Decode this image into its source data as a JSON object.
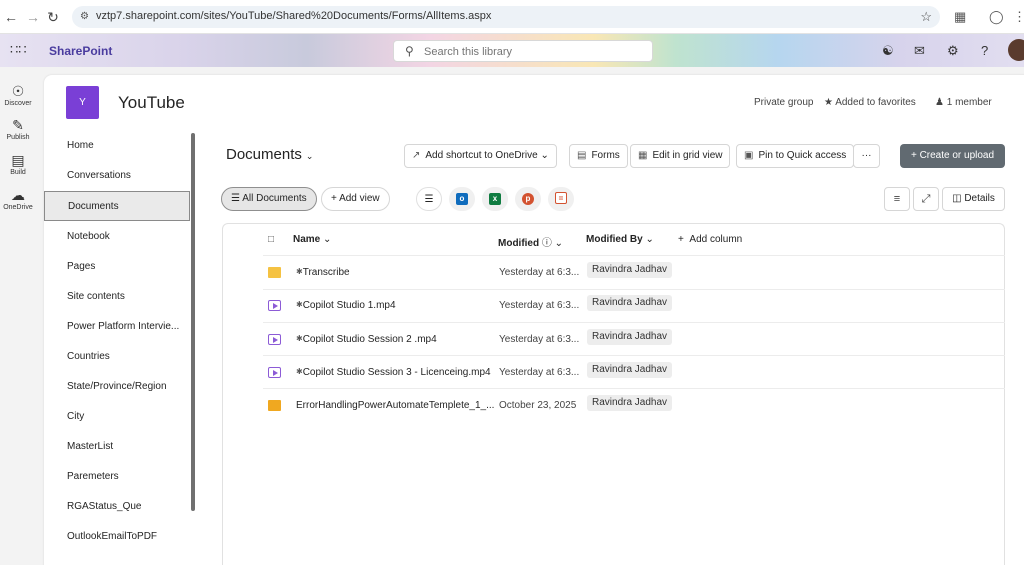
{
  "browser": {
    "url": "vztp7.sharepoint.com/sites/YouTube/Shared%20Documents/Forms/AllItems.aspx"
  },
  "header": {
    "brand": "SharePoint",
    "search_placeholder": "Search this library"
  },
  "app_bar": {
    "items": [
      {
        "label": "Discover",
        "icon": "compass-icon"
      },
      {
        "label": "Publish",
        "icon": "pen-icon"
      },
      {
        "label": "Build",
        "icon": "build-icon"
      },
      {
        "label": "OneDrive",
        "icon": "cloud-icon"
      }
    ]
  },
  "site": {
    "logo_letter": "Y",
    "title": "YouTube",
    "privacy": "Private group",
    "favorites": "Added to favorites",
    "members": "1 member",
    "accent": "#7a3fd6"
  },
  "nav": {
    "items": [
      "Home",
      "Conversations",
      "Documents",
      "Notebook",
      "Pages",
      "Site contents",
      "Power Platform Intervie...",
      "Countries",
      "State/Province/Region",
      "City",
      "MasterList",
      "Paremeters",
      "RGAStatus_Que",
      "OutlookEmailToPDF"
    ],
    "selected": "Documents"
  },
  "library": {
    "title": "Documents",
    "commands": {
      "shortcut": "Add shortcut to OneDrive",
      "forms": "Forms",
      "grid": "Edit in grid view",
      "pin": "Pin to Quick access",
      "more": "···",
      "create": "Create or upload"
    },
    "views": {
      "active": "All Documents",
      "add": "Add view",
      "details": "Details"
    },
    "columns": {
      "name": "Name",
      "modified": "Modified",
      "modified_by": "Modified By",
      "add_column": "Add column"
    },
    "rows": [
      {
        "type": "folder",
        "name": "Transcribe",
        "modified": "Yesterday at 6:3...",
        "modified_by": "Ravindra Jadhav"
      },
      {
        "type": "video",
        "name": "Copilot Studio 1.mp4",
        "modified": "Yesterday at 6:3...",
        "modified_by": "Ravindra Jadhav"
      },
      {
        "type": "video",
        "name": "Copilot Studio Session 2 .mp4",
        "modified": "Yesterday at 6:3...",
        "modified_by": "Ravindra Jadhav"
      },
      {
        "type": "video",
        "name": "Copilot Studio Session 3 - Licenceing.mp4",
        "modified": "Yesterday at 6:3...",
        "modified_by": "Ravindra Jadhav"
      },
      {
        "type": "zip-folder",
        "name": "ErrorHandlingPowerAutomateTemplete_1_...",
        "modified": "October 23, 2025",
        "modified_by": "Ravindra Jadhav"
      }
    ]
  }
}
